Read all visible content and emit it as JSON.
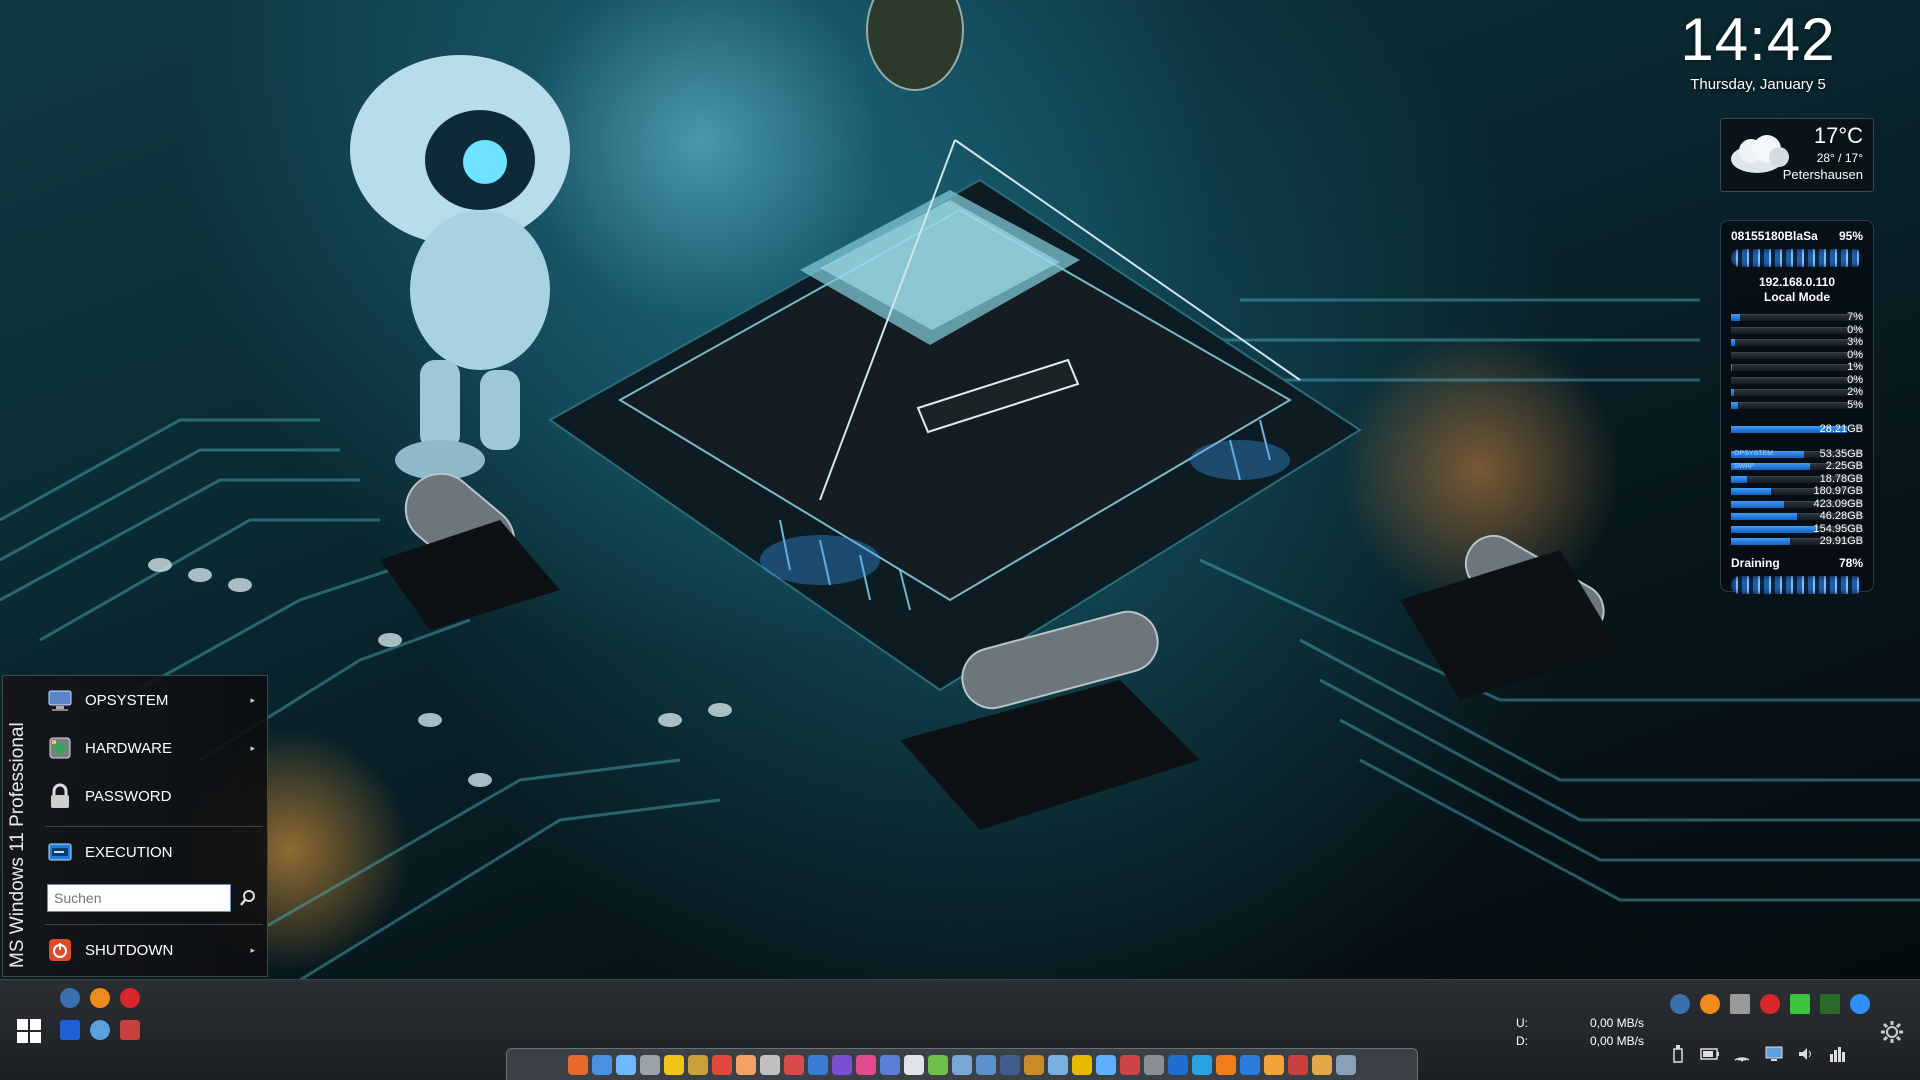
{
  "clock": {
    "time": "14:42",
    "date": "Thursday, January 5"
  },
  "weather": {
    "temperature": "17°C",
    "range": "28° / 17°",
    "city": "Petershausen",
    "icon": "cloud-icon"
  },
  "sysmon": {
    "header_name": "08155180BlaSa",
    "header_pct": "95%",
    "ip": "192.168.0.110",
    "mode": "Local Mode",
    "cpu_bars": [
      {
        "value": "7%",
        "level": 7
      },
      {
        "value": "0%",
        "level": 0
      },
      {
        "value": "3%",
        "level": 3
      },
      {
        "value": "0%",
        "level": 0
      },
      {
        "value": "1%",
        "level": 1
      },
      {
        "value": "0%",
        "level": 0
      },
      {
        "value": "2%",
        "level": 2
      },
      {
        "value": "5%",
        "level": 5
      }
    ],
    "ram": {
      "value": "28.21GB",
      "level": 88
    },
    "drives": [
      {
        "label": "OPSYSTEM",
        "value": "53.35GB",
        "level": 55
      },
      {
        "label": "SWAP",
        "value": "2.25GB",
        "level": 60
      },
      {
        "label": "",
        "value": "18.78GB",
        "level": 12
      },
      {
        "label": "",
        "value": "180.97GB",
        "level": 30
      },
      {
        "label": "",
        "value": "423.09GB",
        "level": 40
      },
      {
        "label": "",
        "value": "46.28GB",
        "level": 50
      },
      {
        "label": "",
        "value": "154.95GB",
        "level": 65
      },
      {
        "label": "",
        "value": "29.91GB",
        "level": 45
      }
    ],
    "power_state": "Draining",
    "power_pct": "78%"
  },
  "startmenu": {
    "sidebar_title": "MS Windows 11 Professional",
    "items": [
      {
        "label": "OPSYSTEM",
        "icon": "computer-icon",
        "has_submenu": true
      },
      {
        "label": "HARDWARE",
        "icon": "hardware-icon",
        "has_submenu": true
      },
      {
        "label": "PASSWORD",
        "icon": "lock-icon",
        "has_submenu": false
      },
      {
        "label": "EXECUTION",
        "icon": "execution-icon",
        "has_submenu": false
      },
      {
        "label": "SHUTDOWN",
        "icon": "power-icon",
        "has_submenu": true
      }
    ],
    "search_placeholder": "Suchen",
    "submenu_arrow": "▸"
  },
  "taskbar": {
    "netmon": {
      "up_label": "U:",
      "up_value": "0,00 MB/s",
      "down_label": "D:",
      "down_value": "0,00 MB/s"
    },
    "colors": {
      "accent": "#2f8fff",
      "orange": "#f08a1c",
      "red": "#d9262b",
      "green": "#3cc43c"
    }
  }
}
